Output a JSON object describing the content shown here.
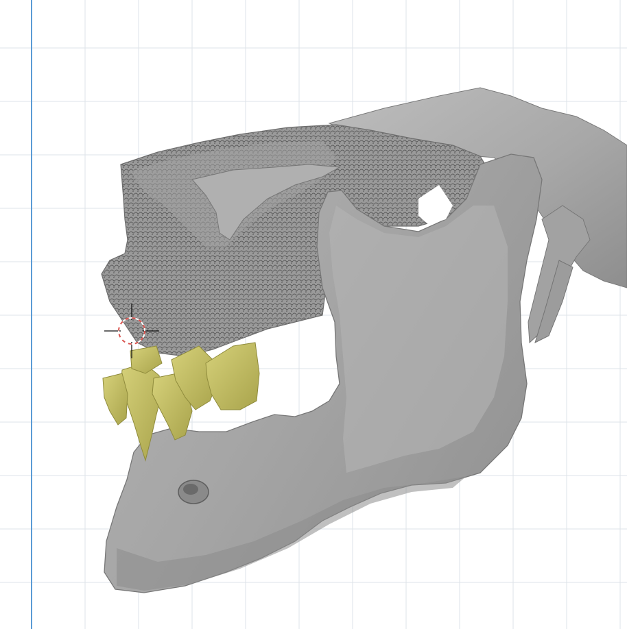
{
  "viewport": {
    "background_color": "#ffffff",
    "grid_color": "#dde3e8",
    "axis_line_color": "#5b9bd5"
  },
  "model": {
    "bone_color": "#a9a9a9",
    "bone_shadow_color": "#7d7d7d",
    "bone_highlight_color": "#c9c9c9",
    "teeth_color": "#c8c46a",
    "teeth_shadow_color": "#9c9a45"
  },
  "cursor": {
    "icon": "3d-cursor-icon",
    "ring_color_a": "#d9534f",
    "ring_color_b": "#ffffff"
  }
}
